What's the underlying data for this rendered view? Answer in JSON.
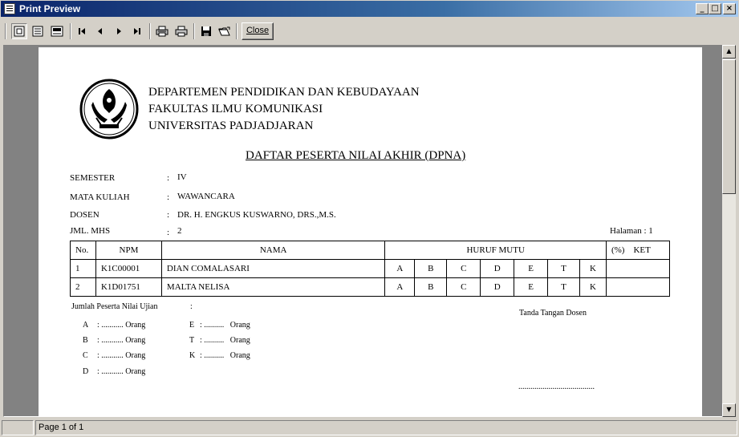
{
  "window": {
    "title": "Print Preview",
    "controls": [
      "_",
      "□",
      "×"
    ]
  },
  "toolbar": {
    "buttons": [
      {
        "name": "whole-page",
        "icon": "whole-page-icon"
      },
      {
        "name": "page-width",
        "icon": "page-width-icon"
      },
      {
        "name": "zoom",
        "icon": "zoom-icon"
      },
      {
        "name": "first-page",
        "icon": "first-page-icon"
      },
      {
        "name": "prev-page",
        "icon": "prev-page-icon"
      },
      {
        "name": "next-page",
        "icon": "next-page-icon"
      },
      {
        "name": "last-page",
        "icon": "last-page-icon"
      },
      {
        "name": "printer-setup",
        "icon": "printer-setup-icon"
      },
      {
        "name": "print",
        "icon": "print-icon"
      },
      {
        "name": "save",
        "icon": "save-icon"
      },
      {
        "name": "open",
        "icon": "open-icon"
      }
    ],
    "close_label": "Close"
  },
  "document": {
    "header": {
      "line1": "DEPARTEMEN PENDIDIKAN DAN KEBUDAYAAN",
      "line2": "FAKULTAS ILMU KOMUNIKASI",
      "line3": "UNIVERSITAS PADJADJARAN"
    },
    "title": "DAFTAR PESERTA NILAI AKHIR (DPNA)",
    "fields": [
      {
        "label": "SEMESTER",
        "colon": ":",
        "value": "IV"
      },
      {
        "label": "MATA KULIAH",
        "colon": ":",
        "value": "WAWANCARA"
      },
      {
        "label": "DOSEN",
        "colon": ":",
        "value": "DR. H. ENGKUS KUSWARNO, DRS.,M.S."
      },
      {
        "label": "JML. MHS",
        "colon": ":",
        "value": "2"
      }
    ],
    "page_label": "Halaman : 1",
    "table": {
      "headers": {
        "no": "No.",
        "npm": "NPM",
        "nama": "NAMA",
        "huruf_mutu": "HURUF MUTU",
        "pct_ket": "(%)    KET"
      },
      "rows": [
        {
          "no": "1",
          "npm": "K1C00001",
          "nama": "DIAN COMALASARI",
          "grades": [
            "A",
            "B",
            "C",
            "D",
            "E",
            "T",
            "K"
          ],
          "ket": ""
        },
        {
          "no": "2",
          "npm": "K1D01751",
          "nama": "MALTA NELISA",
          "grades": [
            "A",
            "B",
            "C",
            "D",
            "E",
            "T",
            "K"
          ],
          "ket": ""
        }
      ]
    },
    "summary": {
      "title": "Jumlah Peserta Nilai Ujian",
      "colon": ":",
      "left": [
        {
          "grade": "A",
          "text": ": ........... Orang"
        },
        {
          "grade": "B",
          "text": ": ........... Orang"
        },
        {
          "grade": "C",
          "text": ": ........... Orang"
        },
        {
          "grade": "D",
          "text": ": ........... Orang"
        }
      ],
      "right": [
        {
          "grade": "E",
          "text": ": ..........   Orang"
        },
        {
          "grade": "T",
          "text": ": ..........   Orang"
        },
        {
          "grade": "K",
          "text": ": ..........   Orang"
        }
      ]
    },
    "signature": {
      "label": "Tanda Tangan Dosen",
      "line": "......................................"
    }
  },
  "statusbar": {
    "page_info": "Page 1 of 1"
  }
}
